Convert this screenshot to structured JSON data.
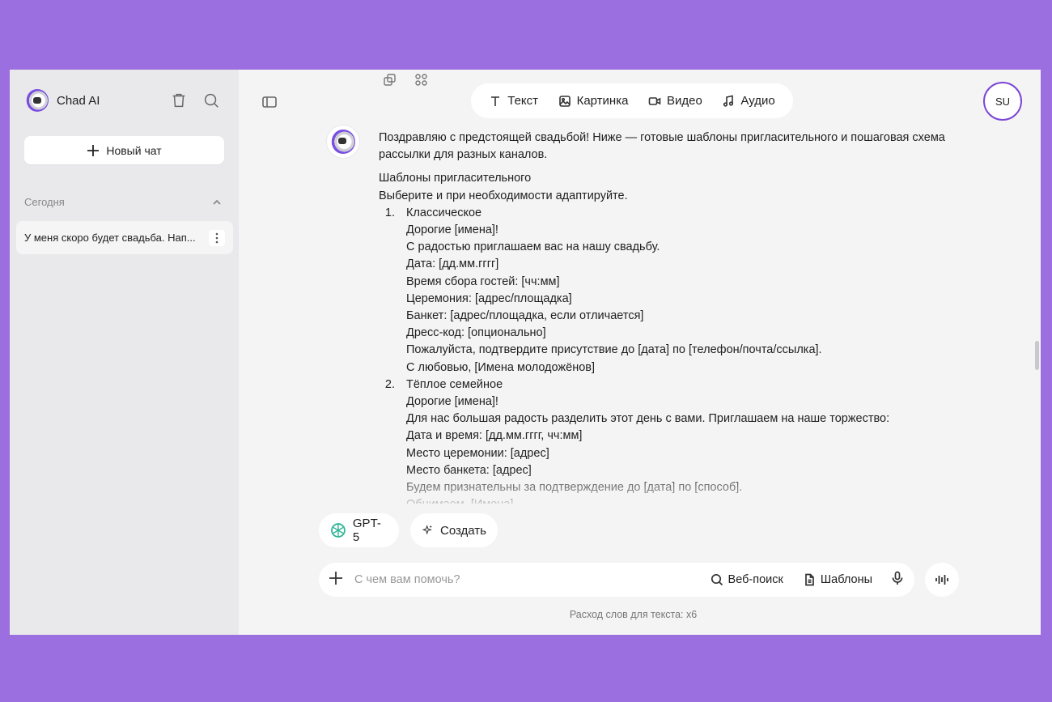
{
  "sidebar": {
    "app_name": "Chad AI",
    "new_chat_label": "Новый чат",
    "section_label": "Сегодня",
    "chats": [
      {
        "title": "У меня скоро будет свадьба. Нап..."
      }
    ]
  },
  "header": {
    "tabs": [
      {
        "label": "Текст",
        "icon": "text-icon"
      },
      {
        "label": "Картинка",
        "icon": "image-icon"
      },
      {
        "label": "Видео",
        "icon": "video-icon"
      },
      {
        "label": "Аудио",
        "icon": "music-icon"
      }
    ],
    "avatar_initials": "SU"
  },
  "message": {
    "intro": "Поздравляю с предстоящей свадьбой! Ниже — готовые шаблоны пригласительного и пошаговая схема рассылки для разных каналов.",
    "heading": "Шаблоны пригласительного",
    "subheading": "Выберите и при необходимости адаптируйте.",
    "templates": [
      {
        "number": "1.",
        "lines": [
          "Классическое",
          "Дорогие [имена]!",
          "С радостью приглашаем вас на нашу свадьбу.",
          "Дата: [дд.мм.гггг]",
          "Время сбора гостей: [чч:мм]",
          "Церемония: [адрес/площадка]",
          "Банкет: [адрес/площадка, если отличается]",
          "Дресс-код: [опционально]",
          "Пожалуйста, подтвердите присутствие до [дата] по [телефон/почта/ссылка].",
          "С любовью, [Имена молодожёнов]"
        ]
      },
      {
        "number": "2.",
        "lines": [
          "Тёплое семейное",
          "Дорогие [имена]!",
          "Для нас большая радость разделить этот день с вами. Приглашаем на наше торжество:",
          "Дата и время: [дд.мм.гггг, чч:мм]",
          "Место церемонии: [адрес]",
          "Место банкета: [адрес]",
          "Будем признательны за подтверждение до [дата] по [способ].",
          "Обнимаем, [Имена]"
        ]
      }
    ]
  },
  "composer": {
    "model_label": "GPT-5",
    "create_label": "Создать",
    "placeholder": "С чем вам помочь?",
    "web_search_label": "Веб-поиск",
    "templates_label": "Шаблоны",
    "usage_note": "Расход слов для текста: x6"
  }
}
